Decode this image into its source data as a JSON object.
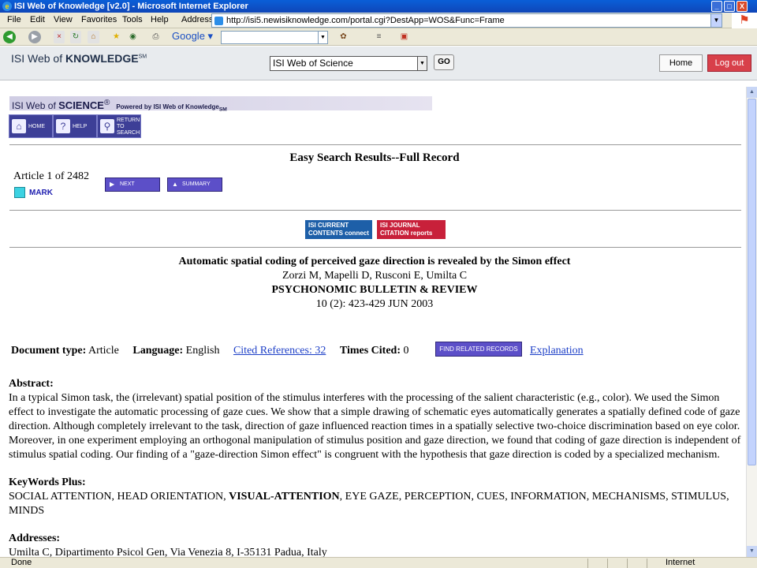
{
  "window": {
    "title": "ISI Web of Knowledge [v2.0] - Microsoft Internet Explorer",
    "minimize": "_",
    "maximize": "□",
    "close": "X"
  },
  "menu": {
    "items": [
      "File",
      "Edit",
      "View",
      "Favorites",
      "Tools",
      "Help"
    ],
    "address_label": "Address",
    "url": "http://isi5.newisiknowledge.com/portal.cgi?DestApp=WOS&Func=Frame"
  },
  "toolbar": {
    "google_label": "Google ▾",
    "google_search_value": ""
  },
  "isi_header": {
    "logo_prefix": "ISI Web of ",
    "logo_bold": "KNOWLEDGE",
    "logo_sup": "SM",
    "database_selected": "ISI Web of Science",
    "go_label": "GO",
    "home_label": "Home",
    "logout_label": "Log out"
  },
  "wos_banner": {
    "prefix": "ISI Web of ",
    "bold": "SCIENCE",
    "reg": "®",
    "powered": "Powered by ISI Web of Knowledge",
    "powered_sm": "SM"
  },
  "nav_buttons": {
    "home": "HOME",
    "help": "HELP",
    "return": "RETURN TO SEARCH"
  },
  "page": {
    "title": "Easy Search Results--Full Record",
    "article_count": "Article 1 of 2482",
    "mark_label": "MARK",
    "next_label": "NEXT",
    "summary_label": "SUMMARY",
    "cc_label_1": "ISI CURRENT",
    "cc_label_2": "CONTENTS connect",
    "jcr_label_1": "ISI JOURNAL",
    "jcr_label_2": "CITATION reports"
  },
  "record": {
    "title": "Automatic spatial coding of perceived gaze direction is revealed by the Simon effect",
    "authors": "Zorzi M, Mapelli D, Rusconi E, Umilta C",
    "journal": "PSYCHONOMIC BULLETIN & REVIEW",
    "volume": "10 (2): 423-429 JUN 2003",
    "doc_type_label": "Document type:",
    "doc_type": "Article",
    "language_label": "Language:",
    "language": "English",
    "cited_refs": "Cited References: 32",
    "times_cited_label": "Times Cited:",
    "times_cited": "0",
    "find_related": "FIND RELATED RECORDS",
    "explanation": "Explanation",
    "abstract_label": "Abstract:",
    "abstract": "In a typical Simon task, the (irrelevant) spatial position of the stimulus interferes with the processing of the salient characteristic (e.g., color). We used the Simon effect to investigate the automatic processing of gaze cues. We show that a simple drawing of schematic eyes automatically generates a spatially defined code of gaze direction. Although completely irrelevant to the task, direction of gaze influenced reaction times in a spatially selective two-choice discrimination based on eye color. Moreover, in one experiment employing an orthogonal manipulation of stimulus position and gaze direction, we found that coding of gaze direction is independent of stimulus spatial coding. Our finding of a \"gaze-direction Simon effect\" is congruent with the hypothesis that gaze direction is coded by a specialized mechanism.",
    "keywords_label": "KeyWords Plus:",
    "keywords_a": "SOCIAL ATTENTION, HEAD ORIENTATION, ",
    "keywords_b": "VISUAL-ATTENTION",
    "keywords_c": ", EYE GAZE, PERCEPTION, CUES, INFORMATION, MECHANISMS, STIMULUS, MINDS",
    "addresses_label": "Addresses:",
    "address_line": "Umilta C, Dipartimento Psicol Gen, Via Venezia 8, I-35131 Padua, Italy"
  },
  "status": {
    "left": "Done",
    "zone": "Internet"
  }
}
